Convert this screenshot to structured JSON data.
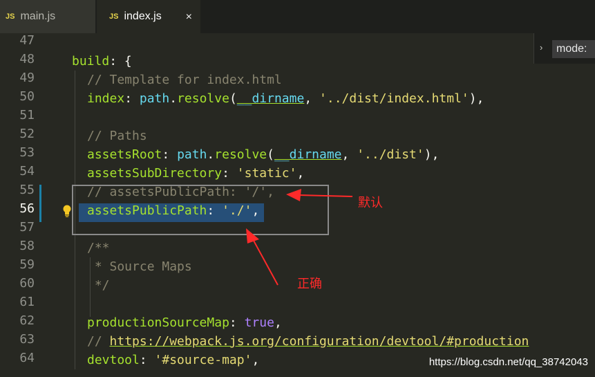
{
  "tabs": [
    {
      "badge": "JS",
      "label": "main.js"
    },
    {
      "badge": "JS",
      "label": "index.js",
      "close": "×"
    }
  ],
  "find_widget": {
    "chevron": "›",
    "value": "mode:"
  },
  "line_numbers": [
    "47",
    "48",
    "49",
    "50",
    "51",
    "52",
    "53",
    "54",
    "55",
    "56",
    "57",
    "58",
    "59",
    "60",
    "61",
    "62",
    "63",
    "64"
  ],
  "code": {
    "l48": {
      "a": "build",
      "b": ": {"
    },
    "l49": {
      "comment": "// Template for index.html"
    },
    "l50": {
      "key": "index",
      "sep": ": ",
      "obj": "path",
      "dot": ".",
      "fn": "resolve",
      "open": "(",
      "arg": "__dirname",
      "comma": ", ",
      "str": "'../dist/index.html'",
      "close": "),"
    },
    "l52": {
      "comment": "// Paths"
    },
    "l53": {
      "key": "assetsRoot",
      "sep": ": ",
      "obj": "path",
      "dot": ".",
      "fn": "resolve",
      "open": "(",
      "arg": "__dirname",
      "comma": ", ",
      "str": "'../dist'",
      "close": "),"
    },
    "l54": {
      "key": "assetsSubDirectory",
      "sep": ": ",
      "str": "'static'",
      "close": ","
    },
    "l55": {
      "comment": "// assetsPublicPath: '/',"
    },
    "l56": {
      "key": "assetsPublicPath",
      "sep": ": ",
      "str": "'./'",
      "close": ","
    },
    "l58": {
      "comment": "/**"
    },
    "l59": {
      "comment": " * Source Maps"
    },
    "l60": {
      "comment": " */"
    },
    "l62": {
      "key": "productionSourceMap",
      "sep": ": ",
      "val": "true",
      "close": ","
    },
    "l63": {
      "prefix": "// ",
      "url": "https://webpack.js.org/configuration/devtool/#production"
    },
    "l64": {
      "key": "devtool",
      "sep": ": ",
      "str": "'#source-map'",
      "close": ","
    }
  },
  "annotations": {
    "default_label": "默认",
    "correct_label": "正确"
  },
  "watermark": "https://blog.csdn.net/qq_38742043",
  "colors": {
    "background": "#272822",
    "selection": "#264f78",
    "annotation": "#ff2a2a",
    "key": "#a6e22e",
    "string": "#e6db74",
    "comment": "#88846f"
  }
}
